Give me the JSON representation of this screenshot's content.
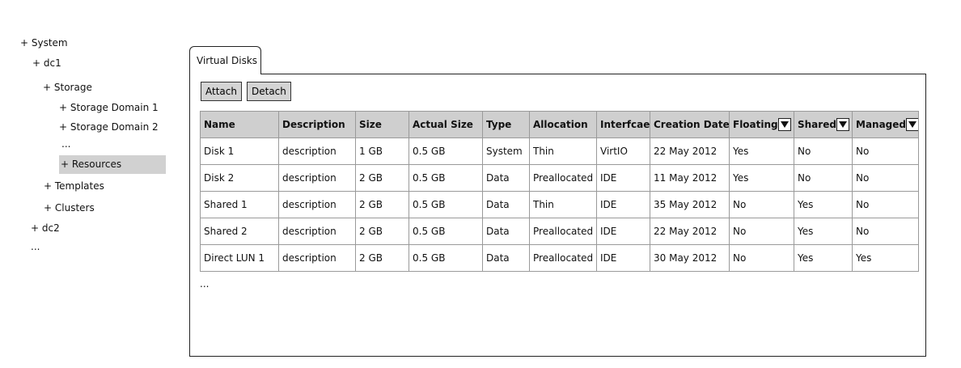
{
  "tree": {
    "items": [
      {
        "label": "+ System"
      },
      {
        "label": "+ dc1"
      },
      {
        "label": "+ Storage"
      },
      {
        "label": "+ Storage Domain 1"
      },
      {
        "label": "+ Storage Domain 2"
      },
      {
        "label": "..."
      },
      {
        "label": "+ Resources"
      },
      {
        "label": "+ Templates"
      },
      {
        "label": "+ Clusters"
      },
      {
        "label": "+ dc2"
      },
      {
        "label": "..."
      }
    ]
  },
  "tabs": [
    {
      "label": "Virtual Disks"
    }
  ],
  "toolbar": {
    "attach_label": "Attach",
    "detach_label": "Detach"
  },
  "table": {
    "columns": [
      "Name",
      "Description",
      "Size",
      "Actual Size",
      "Type",
      "Allocation",
      "Interfcae",
      "Creation Date",
      "Floating",
      "Shared",
      "Managed"
    ],
    "rows": [
      [
        "Disk 1",
        "description",
        "1 GB",
        "0.5 GB",
        "System",
        "Thin",
        "VirtIO",
        "22 May 2012",
        "Yes",
        "No",
        "No"
      ],
      [
        "Disk 2",
        "description",
        "2 GB",
        "0.5 GB",
        "Data",
        "Preallocated",
        "IDE",
        "11 May 2012",
        "Yes",
        "No",
        "No"
      ],
      [
        "Shared 1",
        "description",
        "2 GB",
        "0.5 GB",
        "Data",
        "Thin",
        "IDE",
        "35 May 2012",
        "No",
        "Yes",
        "No"
      ],
      [
        "Shared 2",
        "description",
        "2 GB",
        "0.5 GB",
        "Data",
        "Preallocated",
        "IDE",
        "22 May 2012",
        "No",
        "Yes",
        "No"
      ],
      [
        "Direct LUN 1",
        "description",
        "2 GB",
        "0.5 GB",
        "Data",
        "Preallocated",
        "IDE",
        "30 May 2012",
        "No",
        "Yes",
        "Yes"
      ]
    ],
    "more_label": "..."
  }
}
